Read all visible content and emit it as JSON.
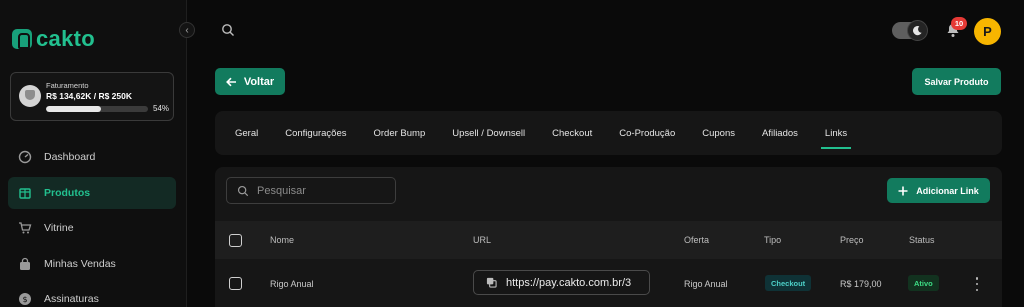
{
  "brand": {
    "name": "cakto",
    "accent": "#22c08f",
    "button_color": "#127b5e"
  },
  "sidebar": {
    "billing": {
      "label": "Faturamento",
      "value": "R$ 134,62K / R$ 250K",
      "percent_label": "54%",
      "progress": 0.54
    },
    "items": [
      {
        "label": "Dashboard",
        "icon": "dashboard-icon",
        "active": false
      },
      {
        "label": "Produtos",
        "icon": "box-icon",
        "active": true
      },
      {
        "label": "Vitrine",
        "icon": "cart-icon",
        "active": false
      },
      {
        "label": "Minhas Vendas",
        "icon": "bag-icon",
        "active": false
      },
      {
        "label": "Assinaturas",
        "icon": "dollar-icon",
        "active": false
      }
    ]
  },
  "header": {
    "notifications_count": "10",
    "avatar_initial": "P"
  },
  "actions": {
    "back_label": "Voltar",
    "save_label": "Salvar Produto"
  },
  "tabs": [
    {
      "label": "Geral",
      "active": false
    },
    {
      "label": "Configurações",
      "active": false
    },
    {
      "label": "Order Bump",
      "active": false
    },
    {
      "label": "Upsell / Downsell",
      "active": false
    },
    {
      "label": "Checkout",
      "active": false
    },
    {
      "label": "Co-Produção",
      "active": false
    },
    {
      "label": "Cupons",
      "active": false
    },
    {
      "label": "Afiliados",
      "active": false
    },
    {
      "label": "Links",
      "active": true
    }
  ],
  "links_table": {
    "search_placeholder": "Pesquisar",
    "add_label": "Adicionar Link",
    "columns": {
      "name": "Nome",
      "url": "URL",
      "offer": "Oferta",
      "type": "Tipo",
      "price": "Preço",
      "status": "Status"
    },
    "rows": [
      {
        "name": "Rigo Anual",
        "url": "https://pay.cakto.com.br/3",
        "offer": "Rigo Anual",
        "type": "Checkout",
        "price": "R$ 179,00",
        "status": "Ativo"
      }
    ]
  }
}
